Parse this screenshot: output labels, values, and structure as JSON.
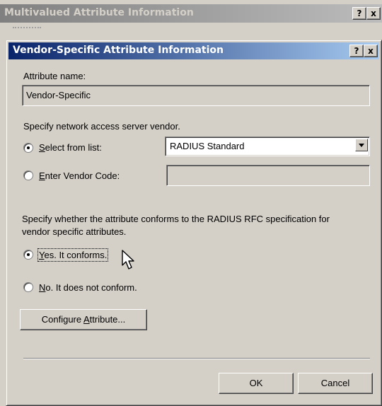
{
  "parent_window": {
    "title": "Multivalued Attribute Information",
    "help_glyph": "?",
    "close_glyph": "x"
  },
  "dialog": {
    "title": "Vendor-Specific Attribute Information",
    "help_glyph": "?",
    "close_glyph": "x"
  },
  "attribute_name": {
    "label": "Attribute name:",
    "value": "Vendor-Specific"
  },
  "vendor_section": {
    "heading": "Specify network access server vendor.",
    "select_from_list_mnemonic": "S",
    "select_from_list_rest": "elect from list:",
    "selected_vendor": "RADIUS Standard",
    "enter_vendor_code_mnemonic": "E",
    "enter_vendor_code_rest": "nter Vendor Code:",
    "vendor_code_value": "",
    "selected_option": "select-from-list"
  },
  "conformance_section": {
    "heading_line1": "Specify whether the attribute conforms to the RADIUS RFC specification for",
    "heading_line2": "vendor specific attributes.",
    "yes_mnemonic": "Y",
    "yes_rest": "es. It conforms.",
    "no_mnemonic": "N",
    "no_rest": "o. It does not conform.",
    "selected_option": "yes"
  },
  "buttons": {
    "configure_prefix": "Configure ",
    "configure_mnemonic": "A",
    "configure_suffix": "ttribute...",
    "ok_label": "OK",
    "cancel_label": "Cancel"
  },
  "icons": {
    "cursor": "mouse-pointer-icon",
    "dropdown": "chevron-down-icon"
  },
  "colors": {
    "titlebar_active_start": "#0a246a",
    "titlebar_active_end": "#a6caf0",
    "titlebar_inactive": "#808080",
    "dialog_face": "#d4d0c8"
  }
}
